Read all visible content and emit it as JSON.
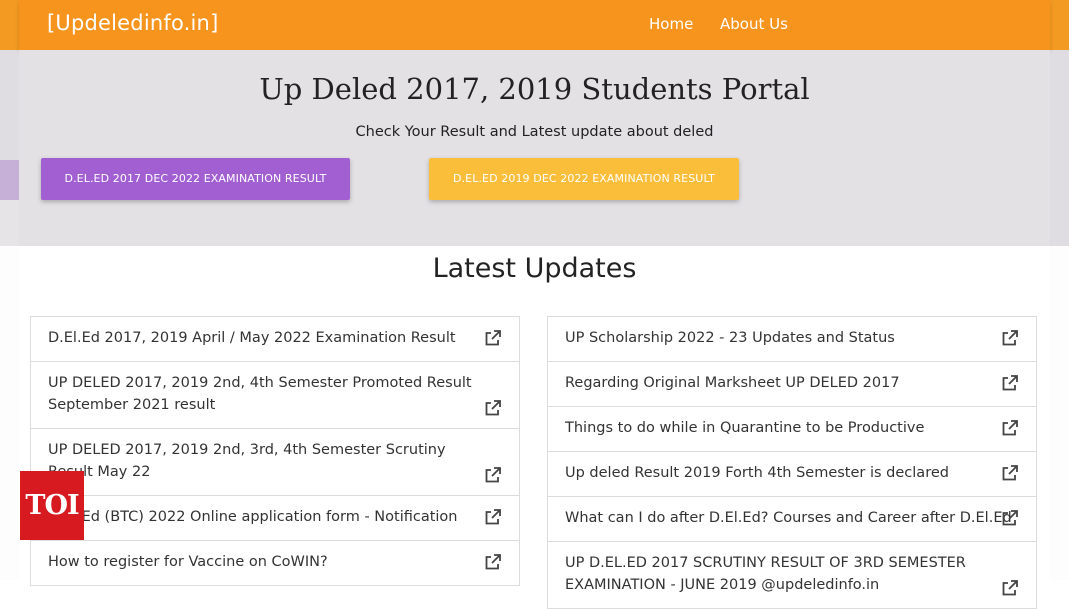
{
  "navbar": {
    "brand": "[Updeledinfo.in]",
    "links": [
      "Home",
      "About Us"
    ]
  },
  "hero": {
    "title": "Up Deled 2017, 2019 Students Portal",
    "subtitle": "Check Your Result and Latest update about deled",
    "buttons": [
      "D.El.Ed 2017 Dec 2022 Examination Result",
      "D.El.Ed 2019 Dec 2022 Examination Result"
    ]
  },
  "latest": {
    "title": "Latest Updates",
    "left": [
      "D.El.Ed 2017, 2019 April / May 2022 Examination Result",
      "UP DELED 2017, 2019 2nd, 4th Semester Promoted Result September 2021 result",
      "UP DELED 2017, 2019 2nd, 3rd, 4th Semester Scrutiny Result May 22",
      "D.El.Ed (BTC) 2022 Online application form - Notification",
      "How to register for Vaccine on CoWIN?"
    ],
    "right": [
      "UP Scholarship 2022 - 23 Updates and Status",
      "Regarding Original Marksheet UP DELED 2017",
      "Things to do while in Quarantine to be Productive",
      "Up deled Result 2019 Forth 4th Semester is declared",
      "What can I do after D.El.Ed? Courses and Career after D.El.Ed",
      "UP D.EL.ED 2017 SCRUTINY RESULT OF 3RD SEMESTER EXAMINATION - JUNE 2019 @updeledinfo.in"
    ]
  },
  "watermark": "TOI",
  "colors": {
    "navbar": "#f7941d",
    "hero_bg": "#e3e1e4",
    "btn_purple": "#a25fd1",
    "btn_yellow": "#fbbe3a",
    "toi_red": "#d71920"
  }
}
